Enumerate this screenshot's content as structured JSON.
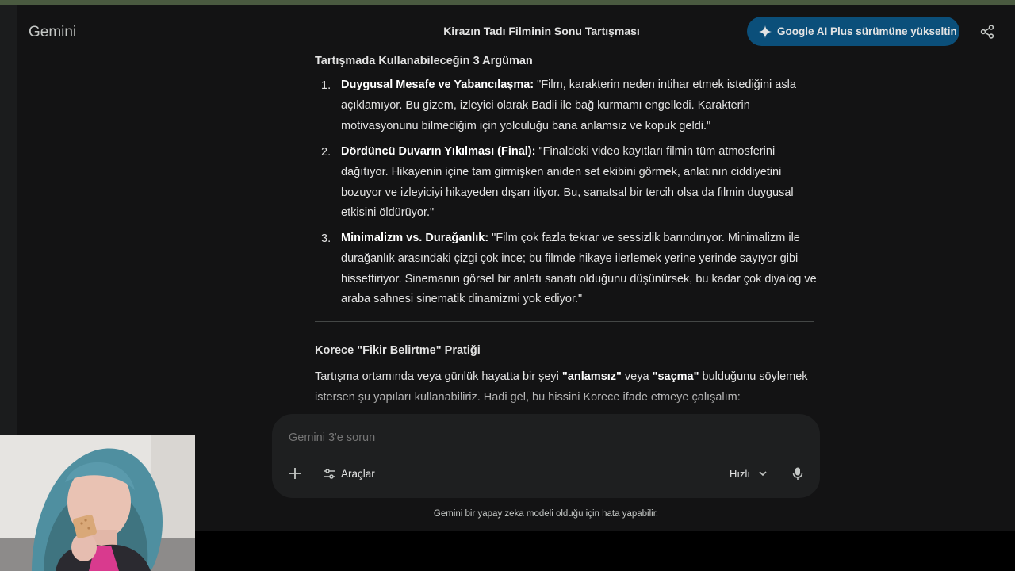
{
  "header": {
    "brand": "Gemini",
    "chat_title": "Kirazın Tadı Filminin Sonu Tartışması",
    "upgrade_label": "Google AI Plus sürümüne yükseltin",
    "share_icon": "share-icon"
  },
  "response": {
    "section1_heading": "Tartışmada Kullanabileceğin 3 Argüman",
    "arguments": [
      {
        "number": "1.",
        "title": "Duygusal Mesafe ve Yabancılaşma:",
        "text": " \"Film, karakterin neden intihar etmek istediğini asla açıklamıyor. Bu gizem, izleyici olarak Badii ile bağ kurmamı engelledi. Karakterin motivasyonunu bilmediğim için yolculuğu bana anlamsız ve kopuk geldi.\""
      },
      {
        "number": "2.",
        "title": "Dördüncü Duvarın Yıkılması (Final):",
        "text": " \"Finaldeki video kayıtları filmin tüm atmosferini dağıtıyor. Hikayenin içine tam girmişken aniden set ekibini görmek, anlatının ciddiyetini bozuyor ve izleyiciyi hikayeden dışarı itiyor. Bu, sanatsal bir tercih olsa da filmin duygusal etkisini öldürüyor.\""
      },
      {
        "number": "3.",
        "title": "Minimalizm vs. Durağanlık:",
        "text": " \"Film çok fazla tekrar ve sessizlik barındırıyor. Minimalizm ile durağanlık arasındaki çizgi çok ince; bu filmde hikaye ilerlemek yerine yerinde sayıyor gibi hissettiriyor. Sinemanın görsel bir anlatı sanatı olduğunu düşünürsek, bu kadar çok diyalog ve araba sahnesi sinematik dinamizmi yok ediyor.\""
      }
    ],
    "section2_heading": "Korece \"Fikir Belirtme\" Pratiği",
    "para_part1": "Tartışma ortamında veya günlük hayatta bir şeyi ",
    "para_bold1": "\"anlamsız\"",
    "para_part2": " veya ",
    "para_bold2": "\"saçma\"",
    "para_part3": " bulduğunu söylemek istersen şu yapıları kullanabiliriz. Hadi gel, bu hissini Korece ifade etmeye çalışalım:"
  },
  "composer": {
    "placeholder": "Gemini 3'e sorun",
    "tools_label": "Araçlar",
    "model_label": "Hızlı",
    "plus_icon": "plus-icon",
    "mic_icon": "mic-icon"
  },
  "disclaimer": "Gemini bir yapay zeka modeli olduğu için hata yapabilir.",
  "colors": {
    "background": "#131314",
    "upgrade_button": "#0b4f7a",
    "composer": "#1e1f20",
    "text": "#e3e3e3"
  }
}
